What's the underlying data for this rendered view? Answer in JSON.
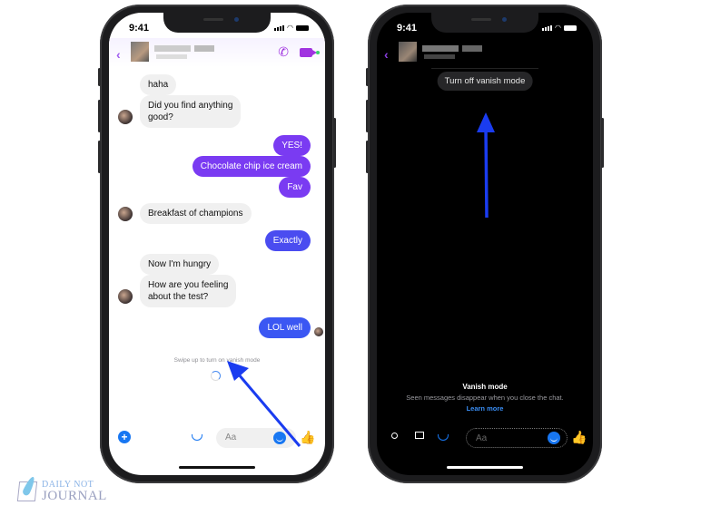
{
  "left_phone": {
    "status_time": "9:41",
    "header": {
      "back_icon": "back-chevron-icon",
      "call_icon": "phone-icon",
      "video_icon": "video-camera-icon"
    },
    "messages": [
      {
        "side": "in",
        "text": "haha"
      },
      {
        "side": "in",
        "text": "Did you find anything",
        "text2": "good?"
      },
      {
        "side": "out",
        "text": "YES!"
      },
      {
        "side": "out",
        "text": "Chocolate chip ice cream"
      },
      {
        "side": "out",
        "text": "Fav"
      },
      {
        "side": "in",
        "text": "Breakfast of champions"
      },
      {
        "side": "out",
        "text": "Exactly"
      },
      {
        "side": "in",
        "text": "Now I'm hungry"
      },
      {
        "side": "in",
        "text": "How are you feeling",
        "text2": "about the test?"
      },
      {
        "side": "out",
        "text": "LOL well"
      }
    ],
    "swipe_hint": "Swipe up to turn on vanish mode",
    "composer": {
      "placeholder": "Aa",
      "plus": "+",
      "thumb": "👍"
    }
  },
  "right_phone": {
    "status_time": "9:41",
    "turn_off_button": "Turn off vanish mode",
    "vanish_title": "Vanish mode",
    "vanish_desc": "Seen messages disappear when you close the chat.",
    "learn_more": "Learn more",
    "composer": {
      "placeholder": "Aa",
      "thumb": "👍"
    }
  },
  "watermark": {
    "line1": "DAILY NOT",
    "line2": "JOURNAL"
  },
  "colors": {
    "accent_purple": "#7a3bf2",
    "accent_blue": "#1877f2",
    "arrow_blue": "#1a3cf0"
  }
}
